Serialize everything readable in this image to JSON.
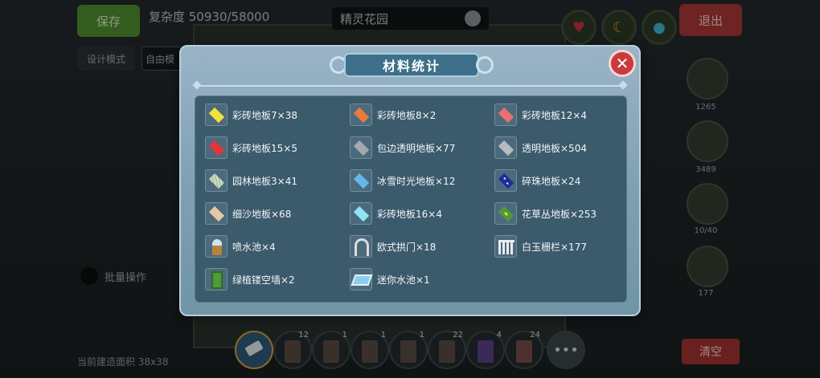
{
  "header": {
    "save_label": "保存",
    "complexity_text": "复杂度 50930/58000",
    "garden_name": "精灵花园",
    "exit_label": "退出"
  },
  "toolbar_left": {
    "design_mode_label": "设计模式",
    "free_label": "自由模"
  },
  "right_panel": {
    "counts": [
      "1265",
      "3489",
      "10/40",
      "177"
    ]
  },
  "batch_label": "批量操作",
  "build_area_text": "当前建造面积 38x38",
  "clear_label": "清空",
  "hotbar": {
    "counts": [
      "12",
      "1",
      "1",
      "1",
      "22",
      "4",
      "24"
    ],
    "more_label": "•••"
  },
  "modal": {
    "title": "材料统计",
    "close_label": "✕",
    "materials": [
      {
        "name": "彩砖地板7×38",
        "icon": "yellow-tile",
        "color": "#f2e23a"
      },
      {
        "name": "彩砖地板8×2",
        "icon": "orange-tile",
        "color": "#ea7a3c"
      },
      {
        "name": "彩砖地板12×4",
        "icon": "pink-tile",
        "color": "#ea7070"
      },
      {
        "name": "彩砖地板15×5",
        "icon": "red-tile",
        "color": "#e2363a"
      },
      {
        "name": "包边透明地板×77",
        "icon": "gray-tile",
        "color": "#a3a9ad"
      },
      {
        "name": "透明地板×504",
        "icon": "gray-tile",
        "color": "#b5bbbf"
      },
      {
        "name": "园林地板3×41",
        "icon": "garden-tile",
        "color": "#a9c2a2"
      },
      {
        "name": "冰雪时光地板×12",
        "icon": "ice-tile",
        "color": "#62b8ec"
      },
      {
        "name": "碎珠地板×24",
        "icon": "starry-tile",
        "color": "#1b2e9a"
      },
      {
        "name": "细沙地板×68",
        "icon": "sand-tile",
        "color": "#e3c9a5"
      },
      {
        "name": "彩砖地板16×4",
        "icon": "cyan-tile",
        "color": "#8ee4f2"
      },
      {
        "name": "花草丛地板×253",
        "icon": "grass-tile",
        "color": "#4f9a38"
      },
      {
        "name": "喷水池×4",
        "icon": "fountain-icon",
        "color": "#cfe4ee"
      },
      {
        "name": "欧式拱门×18",
        "icon": "arch-icon",
        "color": "#d9dde0"
      },
      {
        "name": "白玉栅栏×177",
        "icon": "fence-icon",
        "color": "#e9ecee"
      },
      {
        "name": "绿植镂空墙×2",
        "icon": "green-wall-icon",
        "color": "#4e9b3a"
      },
      {
        "name": "迷你水池×1",
        "icon": "pool-icon",
        "color": "#8ccfef"
      }
    ]
  }
}
